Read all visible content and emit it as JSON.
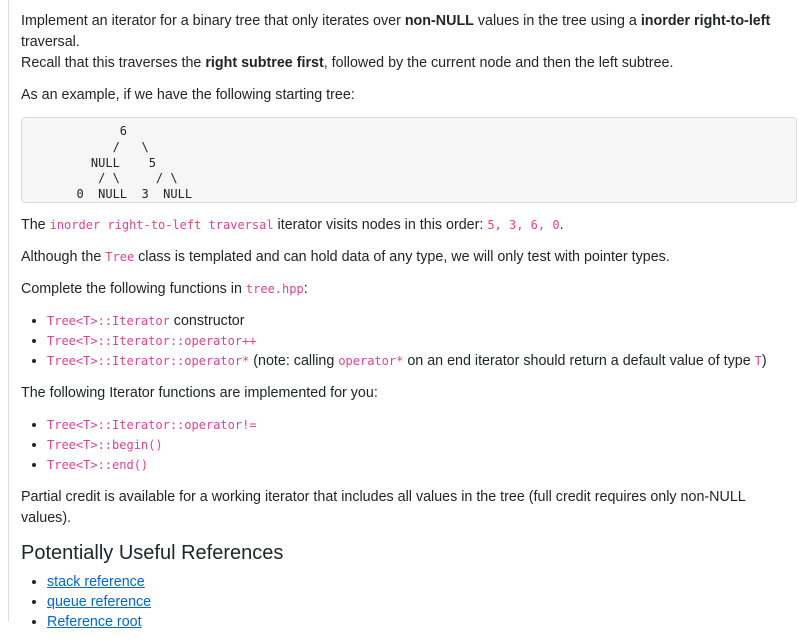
{
  "intro": {
    "t1": "Implement an iterator for a binary tree that only iterates over ",
    "b1": "non-NULL",
    "t2": " values in the tree using a ",
    "b2": "inorder right-to-left",
    "t3": " traversal.",
    "t4": "Recall that this traverses the ",
    "b3": "right subtree first",
    "t5": ", followed by the current node and then the left subtree."
  },
  "example_intro": "As an example, if we have the following starting tree:",
  "tree_code": "        6\n       /   \\\n    NULL    5\n     / \\     / \\\n  0  NULL  3  NULL",
  "visits": {
    "t1": "The ",
    "c1": "inorder right-to-left traversal",
    "t2": " iterator visits nodes in this order: ",
    "c2": "5, 3, 6, 0",
    "t3": "."
  },
  "templated": {
    "t1": "Although the ",
    "c1": "Tree",
    "t2": " class is templated and can hold data of any type, we will only test with pointer types."
  },
  "complete": {
    "t1": "Complete the following functions in ",
    "c1": "tree.hpp",
    "t2": ":"
  },
  "todo": [
    {
      "code": "Tree<T>::Iterator",
      "text": " constructor"
    },
    {
      "code": "Tree<T>::Iterator::operator++"
    },
    {
      "code": "Tree<T>::Iterator::operator*",
      "t1": " (note: calling ",
      "c2": "operator*",
      "t2": " on an end iterator should return a default value of type ",
      "c3": "T",
      "t3": ")"
    }
  ],
  "implemented_intro": "The following Iterator functions are implemented for you:",
  "implemented": [
    "Tree<T>::Iterator::operator!=",
    "Tree<T>::begin()",
    "Tree<T>::end()"
  ],
  "partial": "Partial credit is available for a working iterator that includes all values in the tree (full credit requires only non-NULL values).",
  "references": {
    "heading": "Potentially Useful References",
    "links": [
      "stack reference",
      "queue reference",
      "Reference root"
    ]
  }
}
